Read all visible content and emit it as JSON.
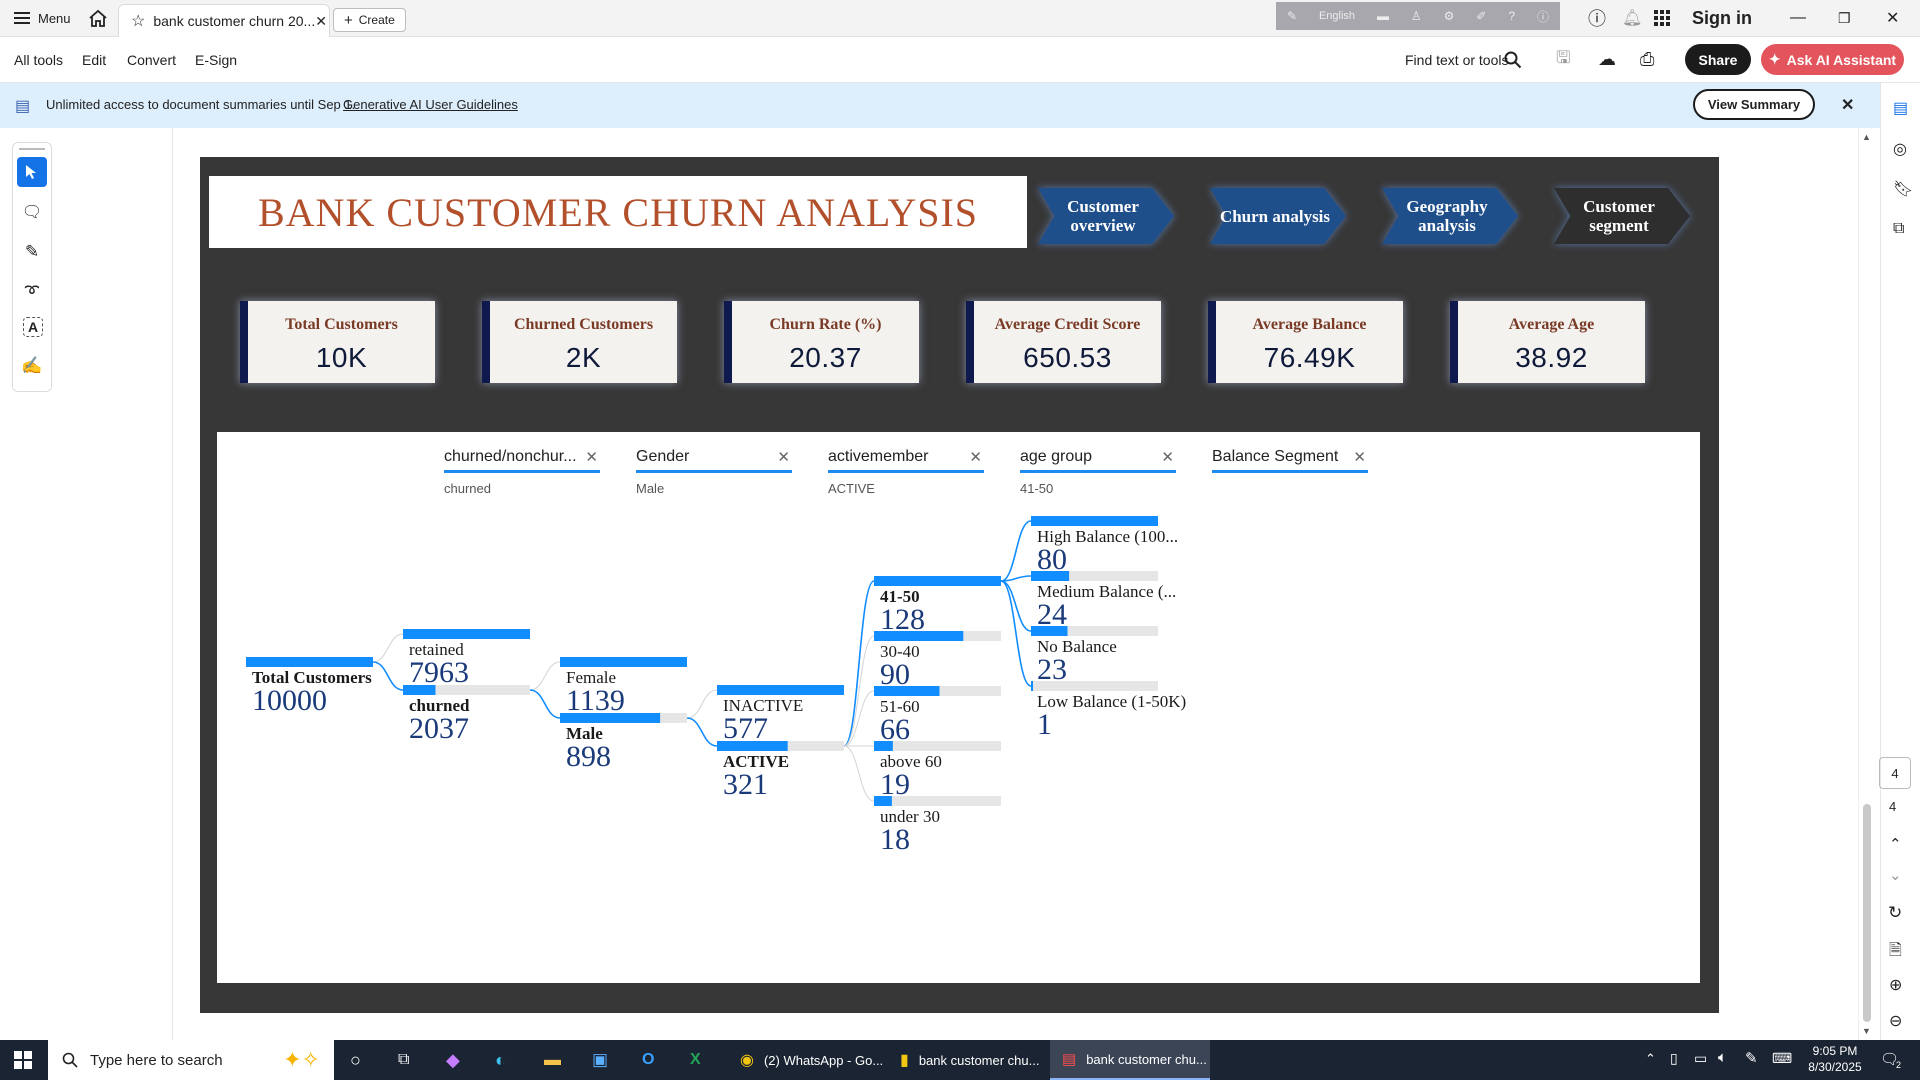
{
  "browser": {
    "menu_label": "Menu",
    "tab_title": "bank customer churn 20...",
    "create_label": "Create",
    "language": "English",
    "sign_in": "Sign in"
  },
  "toolbar": {
    "all_tools": "All tools",
    "edit": "Edit",
    "convert": "Convert",
    "esign": "E-Sign",
    "find": "Find text or tools",
    "share": "Share",
    "ai_assistant": "Ask AI Assistant"
  },
  "banner": {
    "text": "Unlimited access to document summaries until Sep 1.",
    "link": "Generative AI User Guidelines",
    "view_summary": "View Summary"
  },
  "page_nav": {
    "page_box": "4",
    "total": "4"
  },
  "report": {
    "title": "BANK CUSTOMER CHURN ANALYSIS",
    "nav": [
      "Customer overview",
      "Churn analysis",
      "Geography analysis",
      "Customer segment"
    ],
    "kpis": [
      {
        "label": "Total Customers",
        "value": "10K"
      },
      {
        "label": "Churned Customers",
        "value": "2K"
      },
      {
        "label": "Churn Rate (%)",
        "value": "20.37"
      },
      {
        "label": "Average Credit Score",
        "value": "650.53"
      },
      {
        "label": "Average Balance",
        "value": "76.49K"
      },
      {
        "label": "Average Age",
        "value": "38.92"
      }
    ],
    "levels": [
      {
        "header": "churned/nonchurned",
        "header_display": "churned/nonchur...",
        "selected": "churned"
      },
      {
        "header": "Gender",
        "header_display": "Gender",
        "selected": "Male"
      },
      {
        "header": "activemember",
        "header_display": "activemember",
        "selected": "ACTIVE"
      },
      {
        "header": "age group",
        "header_display": "age group",
        "selected": "41-50"
      },
      {
        "header": "Balance Segment",
        "header_display": "Balance Segment",
        "selected": ""
      }
    ]
  },
  "chart_data": {
    "type": "decomposition-tree",
    "root": {
      "label": "Total Customers",
      "value": 10000
    },
    "columns": [
      {
        "nodes": [
          {
            "label": "retained",
            "value": 7963
          },
          {
            "label": "churned",
            "value": 2037,
            "selected": true
          }
        ]
      },
      {
        "nodes": [
          {
            "label": "Female",
            "value": 1139
          },
          {
            "label": "Male",
            "value": 898,
            "selected": true
          }
        ]
      },
      {
        "nodes": [
          {
            "label": "INACTIVE",
            "value": 577
          },
          {
            "label": "ACTIVE",
            "value": 321,
            "selected": true
          }
        ]
      },
      {
        "nodes": [
          {
            "label": "41-50",
            "value": 128,
            "selected": true
          },
          {
            "label": "30-40",
            "value": 90
          },
          {
            "label": "51-60",
            "value": 66
          },
          {
            "label": "above 60",
            "value": 19
          },
          {
            "label": "under 30",
            "value": 18
          }
        ]
      },
      {
        "nodes": [
          {
            "label": "High Balance (100...",
            "value": 80
          },
          {
            "label": "Medium Balance (...",
            "value": 24
          },
          {
            "label": "No Balance",
            "value": 23
          },
          {
            "label": "Low Balance (1-50K)",
            "value": 1
          }
        ]
      }
    ],
    "colors": {
      "bar": "#118dff",
      "track": "#e6e6e6",
      "link": "#118dff"
    }
  },
  "taskbar": {
    "search_placeholder": "Type here to search",
    "apps": [
      {
        "label": "(2) WhatsApp - Go..."
      },
      {
        "label": "bank customer chu..."
      },
      {
        "label": "bank customer chu..."
      }
    ],
    "time": "9:05 PM",
    "date": "8/30/2025",
    "notification_count": "2"
  }
}
